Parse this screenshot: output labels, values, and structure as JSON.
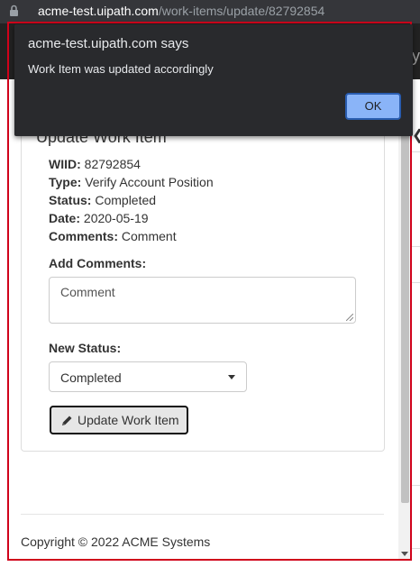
{
  "browser": {
    "url_host": "acme-test.uipath.com",
    "url_path": "/work-items/update/82792854"
  },
  "background": {
    "nav_edge_text": "y"
  },
  "dialog": {
    "title": "acme-test.uipath.com says",
    "message": "Work Item was updated accordingly",
    "ok_label": "OK"
  },
  "panel": {
    "title": "Update Work Item",
    "fields": [
      {
        "label": "WIID:",
        "value": "82792854"
      },
      {
        "label": "Type:",
        "value": "Verify Account Position"
      },
      {
        "label": "Status:",
        "value": "Completed"
      },
      {
        "label": "Date:",
        "value": "2020-05-19"
      },
      {
        "label": "Comments:",
        "value": "Comment"
      }
    ],
    "add_comments_label": "Add Comments:",
    "comment_value": "Comment",
    "new_status_label": "New Status:",
    "new_status_value": "Completed",
    "update_button_label": "Update Work Item"
  },
  "footer": {
    "text": "Copyright © 2022 ACME Systems"
  },
  "colors": {
    "highlight": "#d0021b",
    "dialog_bg": "#292a2d",
    "ok_button": "#8ab4f8"
  }
}
